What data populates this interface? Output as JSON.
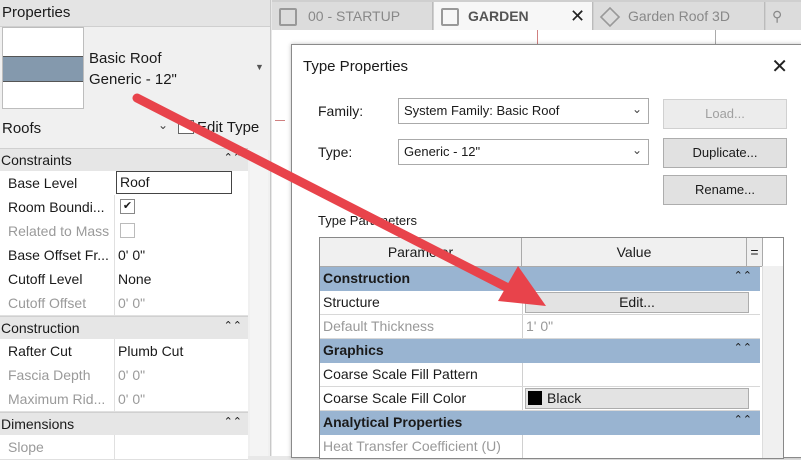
{
  "properties": {
    "title": "Properties",
    "type_family": "Basic Roof",
    "type_name": "Generic - 12\"",
    "category": "Roofs",
    "edit_type": "Edit Type",
    "groups": {
      "constraints": "Constraints",
      "construction": "Construction",
      "dimensions": "Dimensions"
    },
    "rows": {
      "base_level": {
        "name": "Base Level",
        "value": "Roof"
      },
      "room_bounding": {
        "name": "Room Boundi...",
        "checked": "✔"
      },
      "related_to_mass": {
        "name": "Related to Mass"
      },
      "base_offset": {
        "name": "Base Offset Fr...",
        "value": "0'  0\""
      },
      "cutoff_level": {
        "name": "Cutoff Level",
        "value": "None"
      },
      "cutoff_offset": {
        "name": "Cutoff Offset",
        "value": "0'  0\""
      },
      "rafter_cut": {
        "name": "Rafter Cut",
        "value": "Plumb Cut"
      },
      "fascia_depth": {
        "name": "Fascia Depth",
        "value": "0'  0\""
      },
      "maximum_ridge": {
        "name": "Maximum Rid...",
        "value": "0'  0\""
      },
      "slope": {
        "name": "Slope"
      }
    }
  },
  "tabs": [
    {
      "label": "00 - STARTUP"
    },
    {
      "label": "GARDEN",
      "close": "✕"
    },
    {
      "label": "Garden Roof 3D"
    }
  ],
  "dialog": {
    "title": "Type Properties",
    "close": "✕",
    "family_label": "Family:",
    "family_value": "System Family: Basic Roof",
    "type_label": "Type:",
    "type_value": "Generic - 12\"",
    "load": "Load...",
    "duplicate": "Duplicate...",
    "rename": "Rename...",
    "type_parameters": "Type Parameters",
    "col_parameter": "Parameter",
    "col_value": "Value",
    "col_eq": "=",
    "grid": {
      "construction": "Construction",
      "structure": {
        "name": "Structure",
        "button": "Edit..."
      },
      "default_thickness": {
        "name": "Default Thickness",
        "value": "1'  0\""
      },
      "graphics": "Graphics",
      "coarse_pattern": {
        "name": "Coarse Scale Fill Pattern"
      },
      "coarse_color": {
        "name": "Coarse Scale Fill Color",
        "value": "Black"
      },
      "analytical": "Analytical Properties",
      "heat_transfer": {
        "name": "Heat Transfer Coefficient (U)"
      }
    }
  },
  "colors": {
    "arrow": "#e8434b",
    "group_header": "#99b4d1",
    "roof_swatch": "#8499ad"
  }
}
